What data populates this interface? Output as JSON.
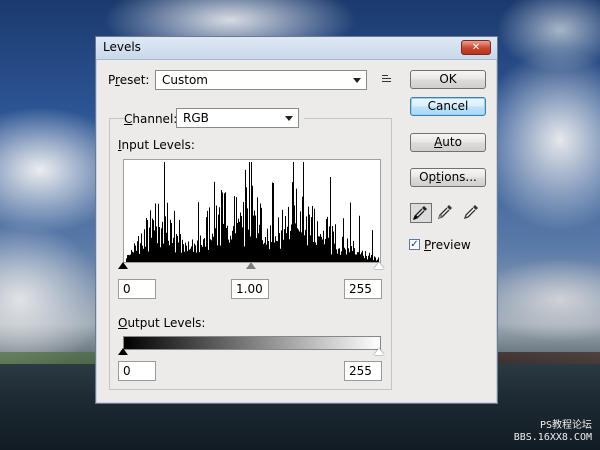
{
  "window": {
    "title": "Levels"
  },
  "preset": {
    "label_prefix": "P",
    "label_underline": "r",
    "label_suffix": "eset:",
    "value": "Custom"
  },
  "channel": {
    "label_prefix": "",
    "label_underline": "C",
    "label_suffix": "hannel:",
    "value": "RGB"
  },
  "input_levels": {
    "label_prefix": "",
    "label_underline": "I",
    "label_suffix": "nput Levels:",
    "black_value": "0",
    "gamma_value": "1.00",
    "white_value": "255"
  },
  "output_levels": {
    "label_prefix": "",
    "label_underline": "O",
    "label_suffix": "utput Levels:",
    "black_value": "0",
    "white_value": "255"
  },
  "buttons": {
    "ok": "OK",
    "cancel": "Cancel",
    "auto_prefix": "",
    "auto_underline": "A",
    "auto_suffix": "uto",
    "options_prefix": "Op",
    "options_underline": "t",
    "options_suffix": "ions..."
  },
  "preview": {
    "checked": true,
    "label_prefix": "",
    "label_underline": "P",
    "label_suffix": "review"
  },
  "watermark": {
    "line1": "PS教程论坛",
    "line2": "BBS.16XX8.COM"
  },
  "icons": {
    "close": "close-icon",
    "preset_menu": "menu-icon",
    "black_eyedropper": "black-eyedropper-icon",
    "gray_eyedropper": "gray-eyedropper-icon",
    "white_eyedropper": "white-eyedropper-icon",
    "checkmark": "checkmark-icon"
  }
}
